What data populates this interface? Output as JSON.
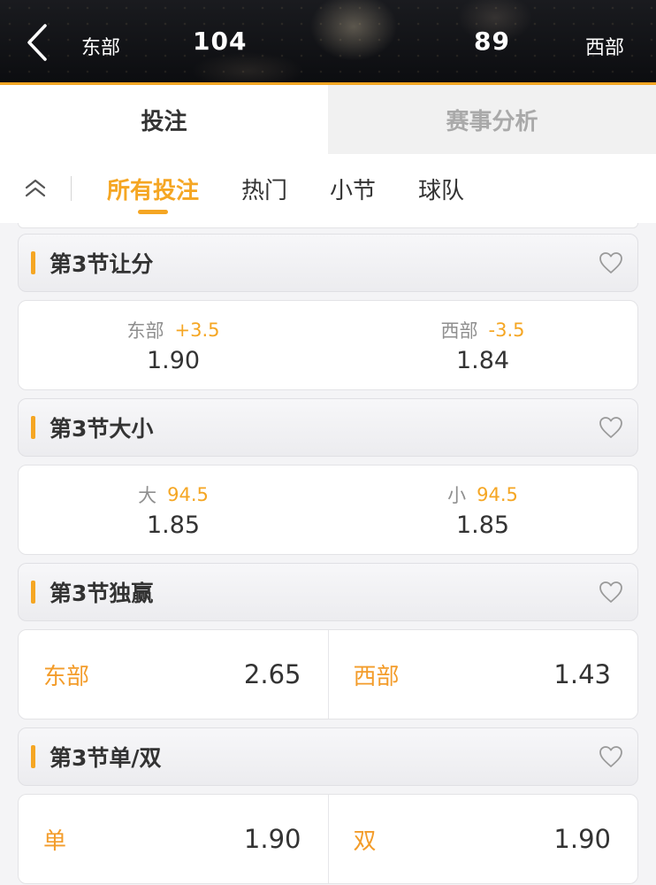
{
  "header": {
    "home_team": "东部",
    "home_score": "104",
    "away_score": "89",
    "away_team": "西部"
  },
  "tabs": [
    {
      "label": "投注",
      "active": true
    },
    {
      "label": "赛事分析",
      "active": false
    }
  ],
  "filters": [
    {
      "label": "所有投注",
      "active": true
    },
    {
      "label": "热门",
      "active": false
    },
    {
      "label": "小节",
      "active": false
    },
    {
      "label": "球队",
      "active": false
    }
  ],
  "markets": [
    {
      "title": "第3节让分",
      "options": [
        {
          "name": "东部",
          "line": "+3.5",
          "odds": "1.90"
        },
        {
          "name": "西部",
          "line": "-3.5",
          "odds": "1.84"
        }
      ]
    },
    {
      "title": "第3节大小",
      "options": [
        {
          "name": "大",
          "line": "94.5",
          "odds": "1.85"
        },
        {
          "name": "小",
          "line": "94.5",
          "odds": "1.85"
        }
      ]
    },
    {
      "title": "第3节独赢",
      "options": [
        {
          "name": "东部",
          "odds": "2.65"
        },
        {
          "name": "西部",
          "odds": "1.43"
        }
      ]
    },
    {
      "title": "第3节单/双",
      "options": [
        {
          "name": "单",
          "odds": "1.90"
        },
        {
          "name": "双",
          "odds": "1.90"
        }
      ]
    }
  ],
  "icons": {
    "back": "chevron-left-icon",
    "collapse": "double-chevron-up-icon",
    "favorite": "heart-outline-icon"
  },
  "colors": {
    "accent": "#f5a623",
    "selection_orange": "#f39c2a",
    "text_dark": "#333333",
    "text_muted": "#8f8f8f"
  }
}
